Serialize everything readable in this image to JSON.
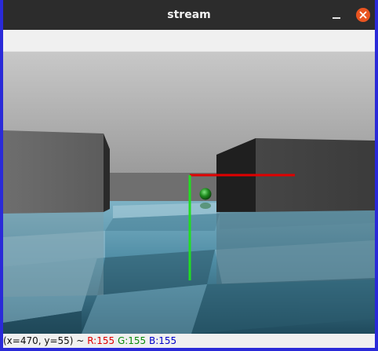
{
  "window": {
    "title": "stream",
    "minimize_icon": "minimize-icon",
    "close_icon": "close-icon",
    "accent_color": "#e95420",
    "frame_color": "#2a2ad8"
  },
  "viewport": {
    "scene": "3d-render",
    "axis_x_color": "#e00000",
    "axis_y_color": "#22dd22",
    "ball_color": "#1f8a1f"
  },
  "status": {
    "coords": "(x=470, y=55) ~",
    "r_label": "R:155",
    "g_label": "G:155",
    "b_label": "B:155"
  }
}
